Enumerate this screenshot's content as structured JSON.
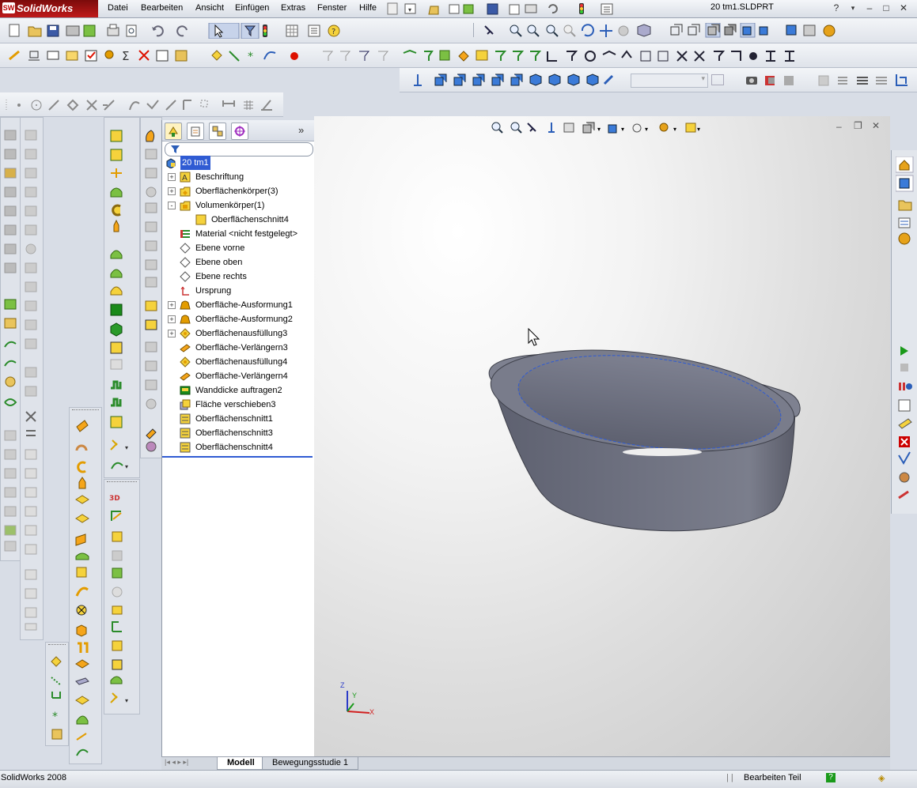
{
  "app": {
    "name": "SolidWorks",
    "logo_badge": "SW",
    "document_title": "20 tm1.SLDPRT"
  },
  "menu": [
    "Datei",
    "Bearbeiten",
    "Ansicht",
    "Einfügen",
    "Extras",
    "Fenster",
    "Hilfe"
  ],
  "feature_tree": {
    "root": "20 tm1",
    "items": [
      {
        "label": "Beschriftung",
        "expander": "+",
        "indent": 0,
        "icon": "annotation-icon"
      },
      {
        "label": "Oberflächenkörper(3)",
        "expander": "+",
        "indent": 0,
        "icon": "surface-bodies-folder-icon"
      },
      {
        "label": "Volumenkörper(1)",
        "expander": "-",
        "indent": 0,
        "icon": "solid-bodies-folder-icon"
      },
      {
        "label": "Oberflächenschnitt4",
        "expander": "",
        "indent": 1,
        "icon": "solid-body-icon"
      },
      {
        "label": "Material <nicht festgelegt>",
        "expander": "",
        "indent": 0,
        "icon": "material-icon"
      },
      {
        "label": "Ebene vorne",
        "expander": "",
        "indent": 0,
        "icon": "plane-icon"
      },
      {
        "label": "Ebene oben",
        "expander": "",
        "indent": 0,
        "icon": "plane-icon"
      },
      {
        "label": "Ebene rechts",
        "expander": "",
        "indent": 0,
        "icon": "plane-icon"
      },
      {
        "label": "Ursprung",
        "expander": "",
        "indent": 0,
        "icon": "origin-icon"
      },
      {
        "label": "Oberfläche-Ausformung1",
        "expander": "+",
        "indent": 0,
        "icon": "surface-loft-icon"
      },
      {
        "label": "Oberfläche-Ausformung2",
        "expander": "+",
        "indent": 0,
        "icon": "surface-loft-icon"
      },
      {
        "label": "Oberflächenausfüllung3",
        "expander": "+",
        "indent": 0,
        "icon": "surface-fill-icon"
      },
      {
        "label": "Oberfläche-Verlängern3",
        "expander": "",
        "indent": 0,
        "icon": "surface-extend-icon"
      },
      {
        "label": "Oberflächenausfüllung4",
        "expander": "",
        "indent": 0,
        "icon": "surface-fill-icon"
      },
      {
        "label": "Oberfläche-Verlängern4",
        "expander": "",
        "indent": 0,
        "icon": "surface-extend-icon"
      },
      {
        "label": "Wanddicke auftragen2",
        "expander": "",
        "indent": 0,
        "icon": "thicken-icon"
      },
      {
        "label": "Fläche verschieben3",
        "expander": "",
        "indent": 0,
        "icon": "move-face-icon"
      },
      {
        "label": "Oberflächenschnitt1",
        "expander": "",
        "indent": 0,
        "icon": "surface-knit-icon"
      },
      {
        "label": "Oberflächenschnitt3",
        "expander": "",
        "indent": 0,
        "icon": "surface-knit-icon"
      },
      {
        "label": "Oberflächenschnitt4",
        "expander": "",
        "indent": 0,
        "icon": "surface-knit-icon"
      }
    ]
  },
  "bottom_tabs": [
    "Modell",
    "Bewegungsstudie 1"
  ],
  "status": {
    "app_version": "SolidWorks 2008",
    "mode": "Bearbeiten Teil"
  },
  "triad": {
    "x": "X",
    "y": "Y",
    "z": "Z"
  },
  "colors": {
    "logo_red": "#b01010",
    "model_gray": "#6b6e7d",
    "selection_blue": "#2f5bd3"
  }
}
